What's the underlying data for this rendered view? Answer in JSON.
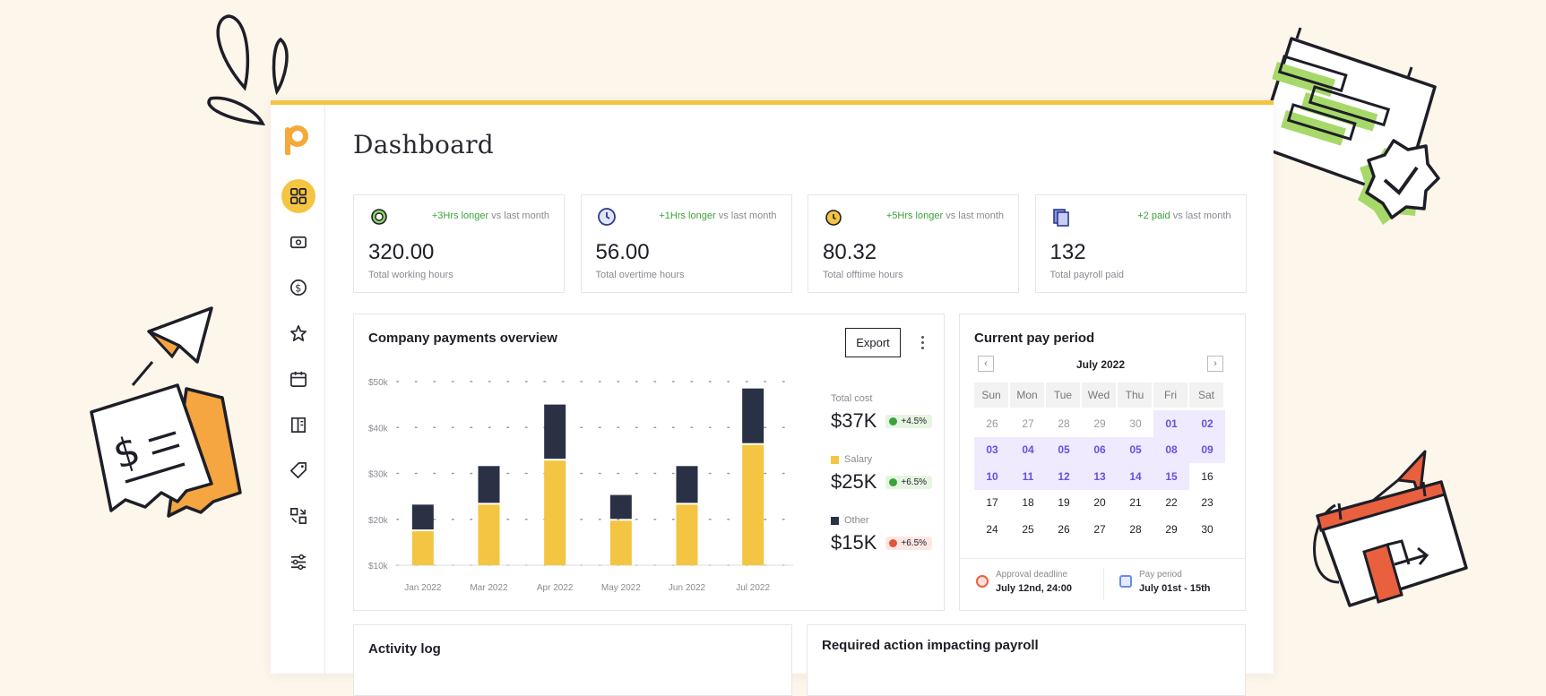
{
  "page": {
    "title": "Dashboard"
  },
  "sidebar": {
    "logo": "p-logo-icon",
    "items": [
      {
        "icon": "grid-icon",
        "active": true
      },
      {
        "icon": "wallet-icon"
      },
      {
        "icon": "coin-icon"
      },
      {
        "icon": "star-icon"
      },
      {
        "icon": "calendar-icon"
      },
      {
        "icon": "book-icon"
      },
      {
        "icon": "tag-icon"
      },
      {
        "icon": "transfer-icon"
      },
      {
        "icon": "sliders-icon"
      }
    ]
  },
  "stats": [
    {
      "icon": "gear-clock-icon",
      "delta_highlight": "+3Hrs longer",
      "delta_rest": " vs last month",
      "value": "320.00",
      "label": "Total working hours"
    },
    {
      "icon": "clock-icon",
      "delta_highlight": "+1Hrs longer",
      "delta_rest": " vs last month",
      "value": "56.00",
      "label": "Total overtime hours"
    },
    {
      "icon": "alarm-icon",
      "delta_highlight": "+5Hrs longer",
      "delta_rest": " vs last month",
      "value": "80.32",
      "label": "Total offtime hours"
    },
    {
      "icon": "document-icon",
      "delta_highlight": "+2 paid",
      "delta_rest": " vs last month",
      "value": "132",
      "label": "Total payroll paid"
    }
  ],
  "payments": {
    "title": "Company payments overview",
    "export_label": "Export",
    "legend": [
      {
        "label": "Total cost",
        "value": "$37K",
        "change": "+4.5%",
        "trend": "up"
      },
      {
        "label": "Salary",
        "value": "$25K",
        "change": "+6.5%",
        "trend": "up",
        "color": "#f4c542"
      },
      {
        "label": "Other",
        "value": "$15K",
        "change": "+6.5%",
        "trend": "down",
        "color": "#2b3145"
      }
    ]
  },
  "chart_data": {
    "type": "bar",
    "stacked": true,
    "categories": [
      "Jan 2022",
      "Mar 2022",
      "Apr 2022",
      "May 2022",
      "Jun 2022",
      "Jul 2022"
    ],
    "series": [
      {
        "name": "Salary",
        "values": [
          17400,
          23200,
          32800,
          19700,
          23200,
          36200
        ],
        "color": "#f4c542"
      },
      {
        "name": "Other",
        "values": [
          5800,
          8400,
          12200,
          5600,
          8400,
          12300
        ],
        "color": "#2b3145"
      }
    ],
    "yticks": [
      "$10k",
      "$20k",
      "$30k",
      "$40k",
      "$50k"
    ],
    "ylim": [
      10000,
      50000
    ],
    "grid": true
  },
  "pay_period": {
    "title": "Current pay period",
    "month": "July 2022",
    "days_of_week": [
      "Sun",
      "Mon",
      "Tue",
      "Wed",
      "Thu",
      "Fri",
      "Sat"
    ],
    "weeks": [
      [
        "26",
        "27",
        "28",
        "29",
        "30",
        "01",
        "02"
      ],
      [
        "03",
        "04",
        "05",
        "06",
        "05",
        "08",
        "09"
      ],
      [
        "10",
        "11",
        "12",
        "13",
        "14",
        "15",
        "16"
      ],
      [
        "17",
        "18",
        "19",
        "20",
        "21",
        "22",
        "23"
      ],
      [
        "24",
        "25",
        "26",
        "27",
        "28",
        "29",
        "30"
      ]
    ],
    "footer": {
      "deadline_label": "Approval deadline",
      "deadline_value": "July 12nd, 24:00",
      "period_label": "Pay period",
      "period_value": "July 01st - 15th"
    }
  },
  "activity": {
    "title": "Activity log"
  },
  "required": {
    "title": "Required action impacting payroll"
  },
  "colors": {
    "accent": "#f4c542",
    "dark": "#2b3145",
    "selection": "#6b4fe0",
    "success": "#3aa33a",
    "danger": "#e0553a"
  }
}
